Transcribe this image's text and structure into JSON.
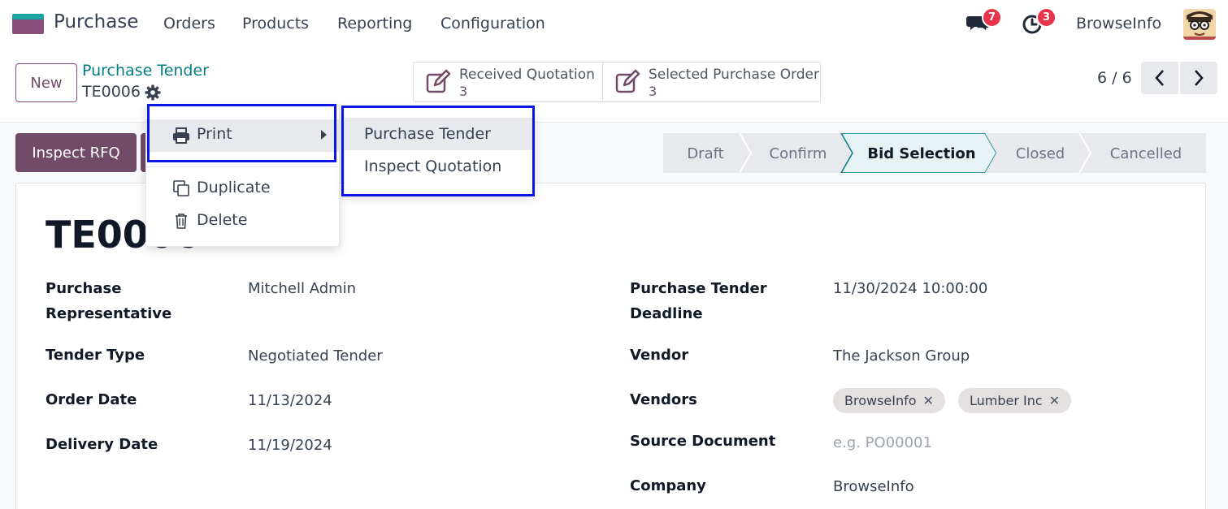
{
  "navbar": {
    "app_name": "Purchase",
    "menu": [
      "Orders",
      "Products",
      "Reporting",
      "Configuration"
    ],
    "messages_count": "7",
    "activities_count": "3",
    "company": "BrowseInfo"
  },
  "control_panel": {
    "new_label": "New",
    "breadcrumb_parent": "Purchase Tender",
    "breadcrumb_current": "TE0006",
    "smart_buttons": [
      {
        "title": "Received Quotation",
        "value": "3"
      },
      {
        "title": "Selected Purchase Order",
        "value": "3"
      }
    ],
    "pager": "6 / 6"
  },
  "actions": {
    "inspect_label": "Inspect RFQ"
  },
  "statusbar": {
    "stages": [
      "Draft",
      "Confirm",
      "Bid Selection",
      "Closed",
      "Cancelled"
    ],
    "active": "Bid Selection"
  },
  "record": {
    "title": "TE0006",
    "left_fields": [
      {
        "label": "Purchase Representative",
        "value": "Mitchell Admin"
      },
      {
        "label": "Tender Type",
        "value": "Negotiated Tender"
      },
      {
        "label": "Order Date",
        "value": "11/13/2024"
      },
      {
        "label": "Delivery Date",
        "value": "11/19/2024"
      }
    ],
    "right_fields": [
      {
        "label": "Purchase Tender Deadline",
        "value": "11/30/2024 10:00:00"
      },
      {
        "label": "Vendor",
        "value": "The Jackson Group"
      },
      {
        "label": "Vendors",
        "tags": [
          "BrowseInfo",
          "Lumber Inc"
        ]
      },
      {
        "label": "Source Document",
        "placeholder": "e.g. PO00001"
      },
      {
        "label": "Company",
        "value": "BrowseInfo"
      }
    ]
  },
  "action_menu": {
    "print": "Print",
    "duplicate": "Duplicate",
    "delete": "Delete",
    "print_submenu": [
      "Purchase Tender",
      "Inspect Quotation"
    ]
  },
  "colors": {
    "primary": "#714b67",
    "link": "#017e84",
    "badge": "#e8344a",
    "highlight_box": "#0a16e6"
  }
}
